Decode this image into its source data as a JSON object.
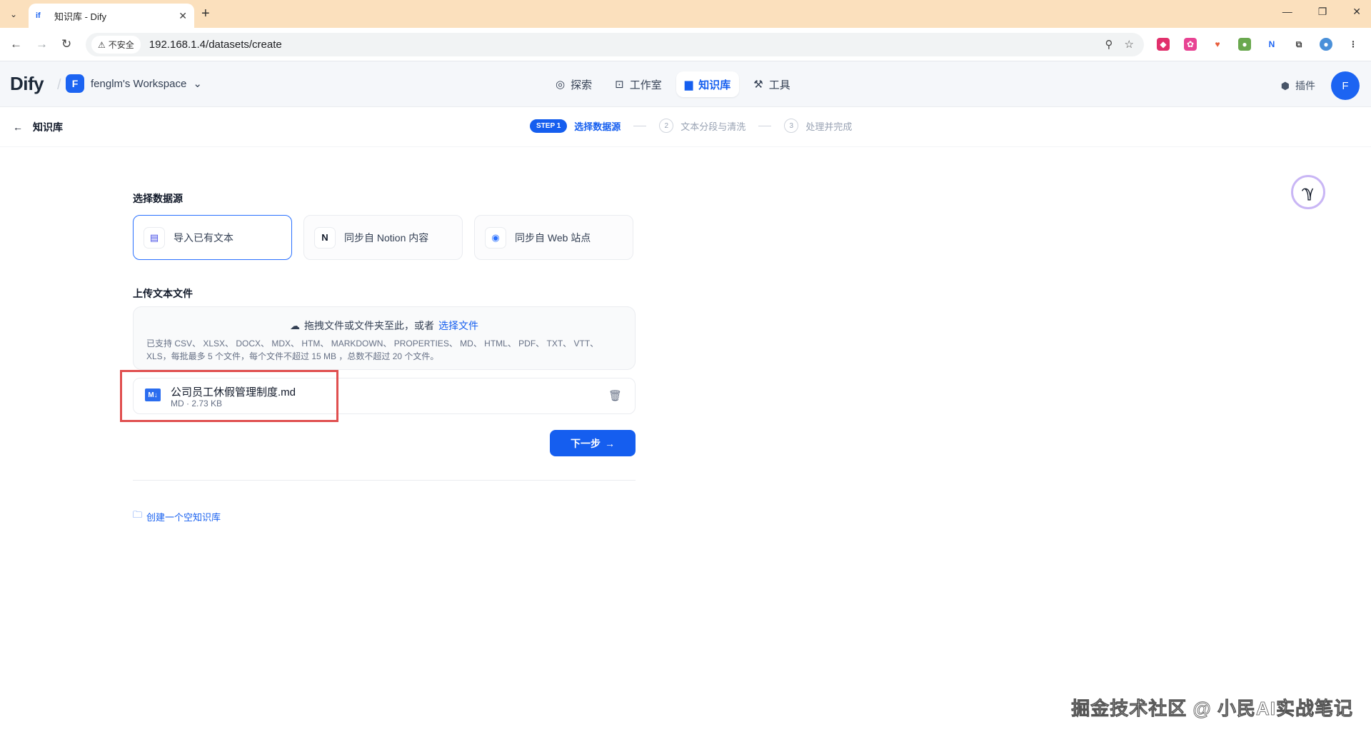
{
  "browser": {
    "tab_title": "知识库 - Dify",
    "url": "192.168.1.4/datasets/create",
    "insecure_label": "不安全"
  },
  "header": {
    "logo_text": "Dify",
    "workspace_initial": "F",
    "workspace_name": "fenglm's Workspace",
    "nav": [
      {
        "label": "探索",
        "icon": "compass-icon",
        "active": false
      },
      {
        "label": "工作室",
        "icon": "robot-icon",
        "active": false
      },
      {
        "label": "知识库",
        "icon": "book-icon",
        "active": true
      },
      {
        "label": "工具",
        "icon": "tool-icon",
        "active": false
      }
    ],
    "plugin_label": "插件",
    "user_initial": "F"
  },
  "subheader": {
    "back_label": "知识库",
    "step1_badge": "STEP 1",
    "step1_label": "选择数据源",
    "step2_num": "2",
    "step2_label": "文本分段与清洗",
    "step3_num": "3",
    "step3_label": "处理并完成"
  },
  "main": {
    "source_title": "选择数据源",
    "sources": [
      {
        "label": "导入已有文本",
        "icon": "file-text-icon",
        "active": true
      },
      {
        "label": "同步自 Notion 内容",
        "icon": "notion-icon",
        "active": false
      },
      {
        "label": "同步自 Web 站点",
        "icon": "globe-icon",
        "active": false
      }
    ],
    "upload_title": "上传文本文件",
    "dropzone_text": "拖拽文件或文件夹至此，或者",
    "dropzone_link": "选择文件",
    "dropzone_hint": "已支持 CSV、 XLSX、 DOCX、 MDX、 HTM、 MARKDOWN、 PROPERTIES、 MD、 HTML、 PDF、 TXT、 VTT、 XLS，每批最多 5 个文件，每个文件不超过 15 MB ，总数不超过 20 个文件。",
    "file": {
      "badge": "M↓",
      "name": "公司员工休假管理制度.md",
      "meta": "MD · 2.73 KB"
    },
    "next_button": "下一步",
    "empty_kb_link": "创建一个空知识库"
  },
  "watermark": "掘金技术社区 @ 小民AI实战笔记",
  "colors": {
    "accent": "#155eef",
    "highlight_box": "#e04f4f",
    "tabbar_bg": "#fbe0bd"
  }
}
